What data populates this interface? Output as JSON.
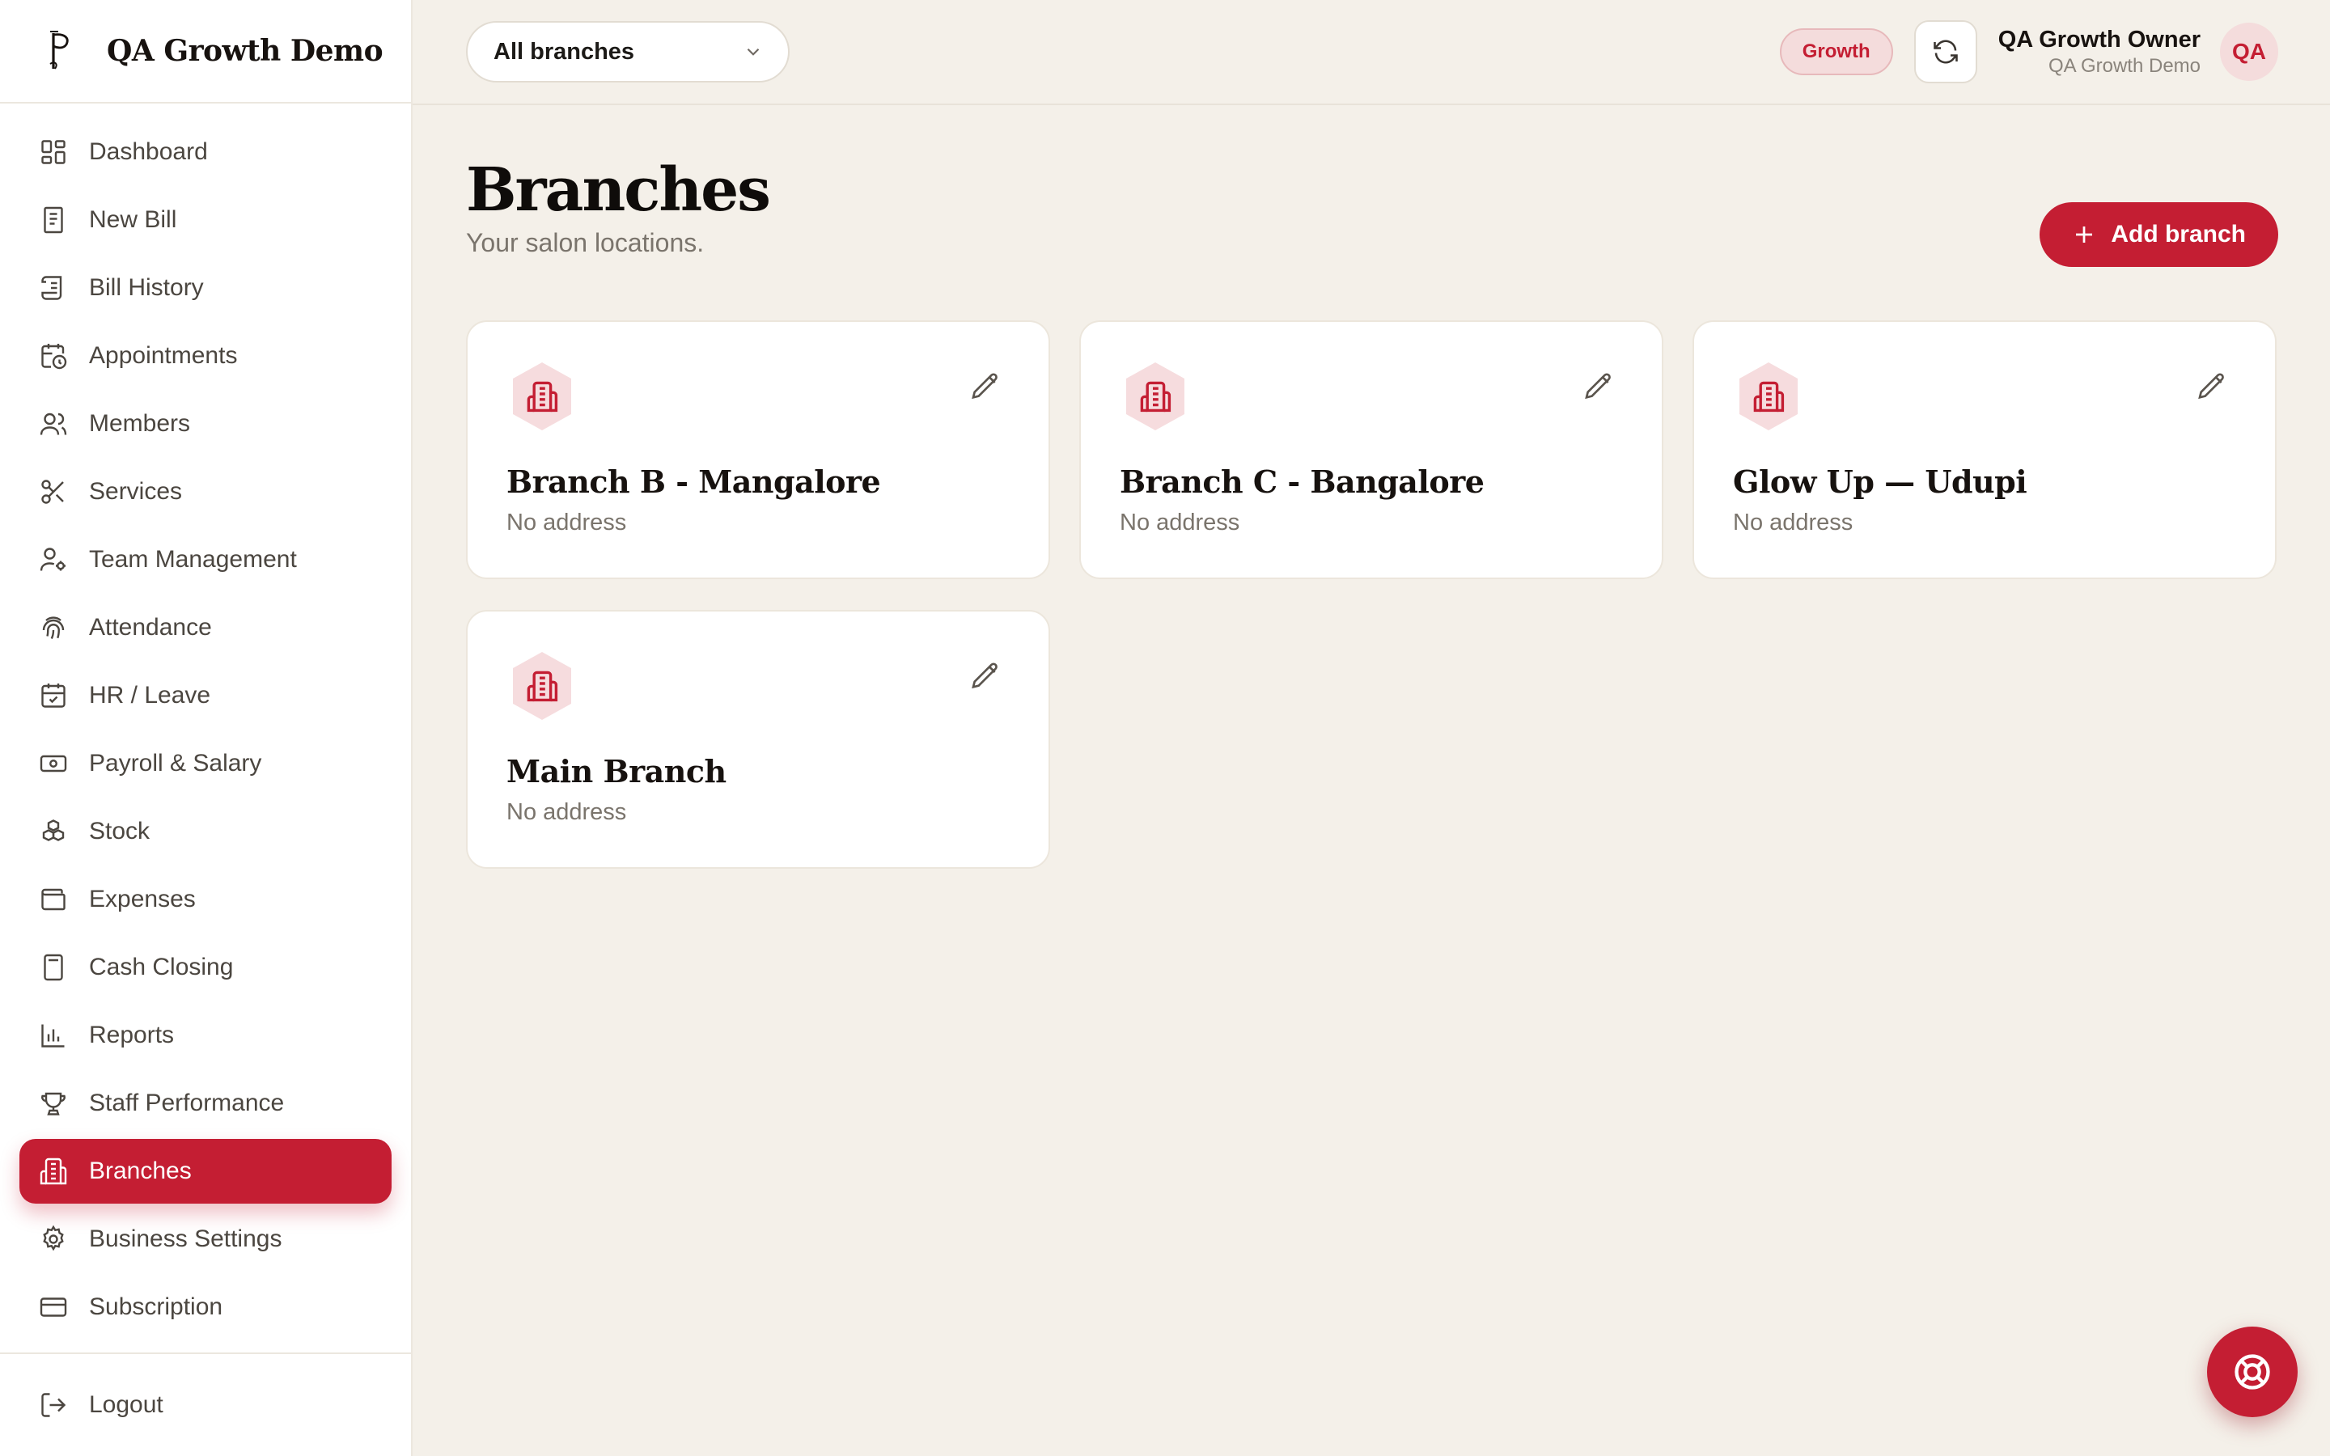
{
  "brand": {
    "name": "QA Growth Demo",
    "logo_icon": "serif-p-logo-icon"
  },
  "sidebar": {
    "items": [
      {
        "label": "Dashboard",
        "icon": "dashboard-icon",
        "active": false
      },
      {
        "label": "New Bill",
        "icon": "receipt-icon",
        "active": false
      },
      {
        "label": "Bill History",
        "icon": "scroll-icon",
        "active": false
      },
      {
        "label": "Appointments",
        "icon": "calendar-clock-icon",
        "active": false
      },
      {
        "label": "Members",
        "icon": "users-icon",
        "active": false
      },
      {
        "label": "Services",
        "icon": "scissors-icon",
        "active": false
      },
      {
        "label": "Team Management",
        "icon": "user-cog-icon",
        "active": false
      },
      {
        "label": "Attendance",
        "icon": "fingerprint-icon",
        "active": false
      },
      {
        "label": "HR / Leave",
        "icon": "calendar-check-icon",
        "active": false
      },
      {
        "label": "Payroll & Salary",
        "icon": "banknote-icon",
        "active": false
      },
      {
        "label": "Stock",
        "icon": "boxes-icon",
        "active": false
      },
      {
        "label": "Expenses",
        "icon": "wallet-icon",
        "active": false
      },
      {
        "label": "Cash Closing",
        "icon": "calculator-icon",
        "active": false
      },
      {
        "label": "Reports",
        "icon": "bar-chart-icon",
        "active": false
      },
      {
        "label": "Staff Performance",
        "icon": "trophy-icon",
        "active": false
      },
      {
        "label": "Branches",
        "icon": "building-icon",
        "active": true
      },
      {
        "label": "Business Settings",
        "icon": "gear-icon",
        "active": false
      },
      {
        "label": "Subscription",
        "icon": "credit-card-icon",
        "active": false
      }
    ],
    "logout_label": "Logout"
  },
  "topbar": {
    "branch_select_value": "All branches",
    "plan_badge": "Growth",
    "user_name": "QA Growth Owner",
    "user_business": "QA Growth Demo",
    "avatar_initials": "QA"
  },
  "page": {
    "title": "Branches",
    "subtitle": "Your salon locations.",
    "add_button_label": "Add branch"
  },
  "branches": [
    {
      "name": "Branch B - Mangalore",
      "address": "No address"
    },
    {
      "name": "Branch C - Bangalore",
      "address": "No address"
    },
    {
      "name": "Glow Up — Udupi",
      "address": "No address"
    },
    {
      "name": "Main Branch",
      "address": "No address"
    }
  ],
  "colors": {
    "accent": "#c41e33",
    "background": "#f4f0e9",
    "card": "#ffffff",
    "badge_bg": "#f4dcdc"
  }
}
